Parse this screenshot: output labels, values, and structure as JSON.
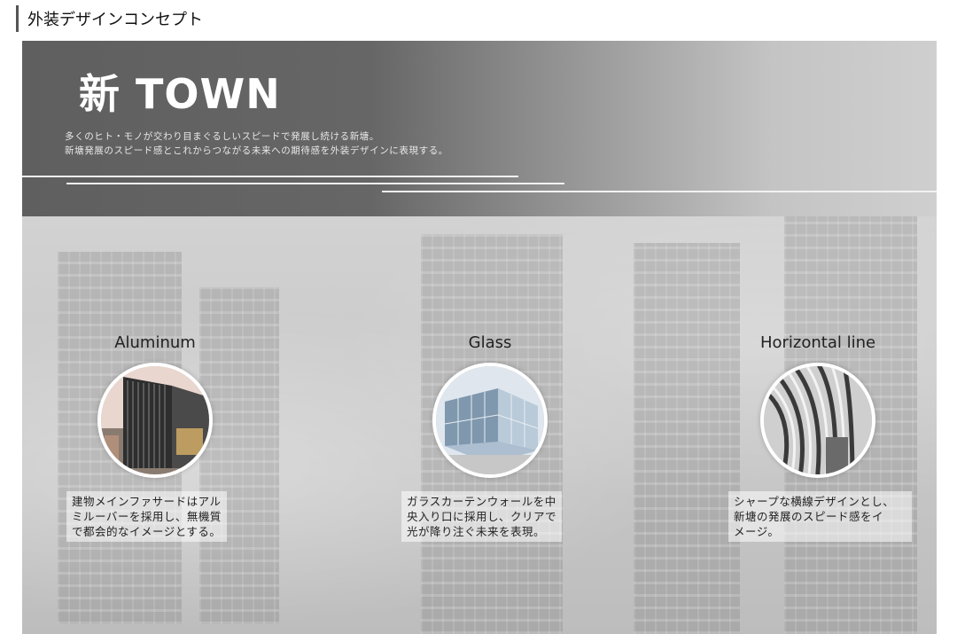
{
  "page": {
    "title": "外装デザインコンセプト"
  },
  "header": {
    "title": "新 TOWN",
    "lines": [
      "多くのヒト・モノが交わり目まぐるしいスピードで発展し続ける新塘。",
      "新塘発展のスピード感とこれからつながる未来への期待感を外装デザインに表現する。"
    ]
  },
  "concepts": [
    {
      "label": "Aluminum",
      "caption": [
        "建物メインファサードはアル",
        "ミルーバーを採用し、無機質",
        "で都会的なイメージとする。"
      ]
    },
    {
      "label": "Glass",
      "caption": [
        "ガラスカーテンウォールを中",
        "央入り口に採用し、クリアで",
        "光が降り注ぐ未来を表現。"
      ]
    },
    {
      "label": "Horizontal line",
      "caption": [
        "シャープな横線デザインとし、",
        "新塘の発展のスピード感をイ",
        "メージ。"
      ]
    }
  ]
}
